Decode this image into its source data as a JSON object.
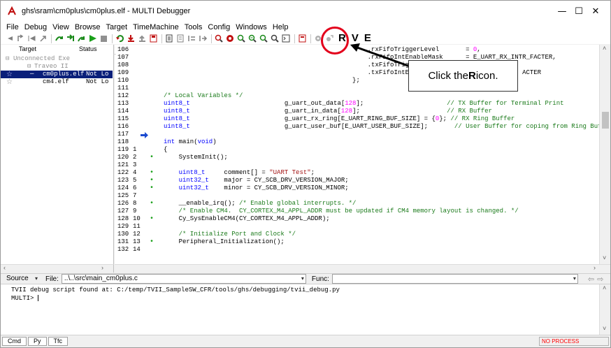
{
  "window": {
    "title": "ghs\\sram\\cm0plus\\cm0plus.elf - MULTI Debugger",
    "controls": {
      "minimize": "—",
      "maximize": "☐",
      "close": "✕"
    }
  },
  "menu": [
    "File",
    "Debug",
    "View",
    "Browse",
    "Target",
    "TimeMachine",
    "Tools",
    "Config",
    "Windows",
    "Help"
  ],
  "toolbar": {
    "letters": [
      "R",
      "V",
      "E"
    ],
    "icons": [
      "back-arrow-icon",
      "up-arrow-icon",
      "step-back-icon",
      "step-back2-icon",
      "step-over-icon",
      "step-into-icon",
      "step-out-icon",
      "run-icon",
      "halt-icon",
      "restart-icon",
      "download-icon",
      "upload-icon",
      "save-icon",
      "connect-icon",
      "memory-icon",
      "view-icon",
      "register-icon",
      "trace-icon",
      "search-icon",
      "breakpoint-icon",
      "zoom-in-icon",
      "zoom-out-icon",
      "find-icon",
      "shell-icon",
      "calc-icon",
      "settings-icon",
      "plugin-icon"
    ]
  },
  "target_pane": {
    "header": {
      "target": "Target",
      "status": "Status"
    },
    "rows": [
      {
        "label": "Unconnected Exe",
        "status": "",
        "style": "gray"
      },
      {
        "label": "Traveo II",
        "status": "",
        "style": "gray"
      },
      {
        "label": "cm0plus.elf",
        "status": "Not Lo",
        "style": "selected"
      },
      {
        "label": "cm4.elf",
        "status": "Not Lo",
        "style": "normal"
      }
    ]
  },
  "source": {
    "lines": [
      {
        "n": "106",
        "n2": "",
        "dot": false,
        "code": [
          {
            "t": "                                                      .rxFifoTriggerLevel       = ",
            "c": ""
          },
          {
            "t": "0",
            "c": "nm"
          },
          {
            "t": ",",
            "c": ""
          }
        ]
      },
      {
        "n": "107",
        "n2": "",
        "dot": false,
        "code": [
          {
            "t": "                                                      .rxFifoIntEnableMask      = E_UART_RX_INTR_FACTER,",
            "c": ""
          }
        ]
      },
      {
        "n": "108",
        "n2": "",
        "dot": false,
        "code": [
          {
            "t": "                                                      .txFifoTriggerLe",
            "c": ""
          }
        ]
      },
      {
        "n": "109",
        "n2": "",
        "dot": false,
        "code": [
          {
            "t": "                                                      .txFifoIntEnable                         ACTER",
            "c": ""
          }
        ]
      },
      {
        "n": "110",
        "n2": "",
        "dot": false,
        "code": [
          {
            "t": "                                                  };",
            "c": ""
          }
        ]
      },
      {
        "n": "111",
        "n2": "",
        "dot": false,
        "code": []
      },
      {
        "n": "112",
        "n2": "",
        "dot": false,
        "code": [
          {
            "t": "/* Local Variables */",
            "c": "cm"
          }
        ]
      },
      {
        "n": "113",
        "n2": "",
        "dot": false,
        "code": [
          {
            "t": "uint8_t",
            "c": "kw"
          },
          {
            "t": "                         g_uart_out_data[",
            "c": ""
          },
          {
            "t": "128",
            "c": "nm"
          },
          {
            "t": "];                      ",
            "c": ""
          },
          {
            "t": "// TX Buffer for Terminal Print",
            "c": "cm"
          }
        ]
      },
      {
        "n": "114",
        "n2": "",
        "dot": false,
        "code": [
          {
            "t": "uint8_t",
            "c": "kw"
          },
          {
            "t": "                         g_uart_in_data[",
            "c": ""
          },
          {
            "t": "128",
            "c": "nm"
          },
          {
            "t": "];                       ",
            "c": ""
          },
          {
            "t": "// RX Buffer",
            "c": "cm"
          }
        ]
      },
      {
        "n": "115",
        "n2": "",
        "dot": false,
        "code": [
          {
            "t": "uint8_t",
            "c": "kw"
          },
          {
            "t": "                         g_uart_rx_ring[E_UART_RING_BUF_SIZE] = {",
            "c": ""
          },
          {
            "t": "0",
            "c": "nm"
          },
          {
            "t": "}; ",
            "c": ""
          },
          {
            "t": "// RX Ring Buffer",
            "c": "cm"
          }
        ]
      },
      {
        "n": "116",
        "n2": "",
        "dot": false,
        "code": [
          {
            "t": "uint8_t",
            "c": "kw"
          },
          {
            "t": "                         g_uart_user_buf[E_UART_USER_BUF_SIZE];       ",
            "c": ""
          },
          {
            "t": "// User Buffer for coping from Ring Buffer",
            "c": "cm"
          }
        ]
      },
      {
        "n": "117",
        "n2": "",
        "dot": false,
        "code": []
      },
      {
        "n": "118",
        "n2": "",
        "dot": false,
        "code": [
          {
            "t": "int",
            "c": "kw"
          },
          {
            "t": " main(",
            "c": ""
          },
          {
            "t": "void",
            "c": "kw"
          },
          {
            "t": ")",
            "c": ""
          }
        ]
      },
      {
        "n": "119",
        "n2": "1",
        "dot": false,
        "code": [
          {
            "t": "{",
            "c": ""
          }
        ]
      },
      {
        "n": "120",
        "n2": "2",
        "dot": true,
        "code": [
          {
            "t": "    SystemInit();",
            "c": ""
          }
        ]
      },
      {
        "n": "121",
        "n2": "3",
        "dot": false,
        "code": []
      },
      {
        "n": "122",
        "n2": "4",
        "dot": true,
        "code": [
          {
            "t": "    ",
            "c": ""
          },
          {
            "t": "uint8_t",
            "c": "kw"
          },
          {
            "t": "     comment[] = ",
            "c": ""
          },
          {
            "t": "\"UART Test\"",
            "c": "st"
          },
          {
            "t": ";",
            "c": ""
          }
        ]
      },
      {
        "n": "123",
        "n2": "5",
        "dot": true,
        "code": [
          {
            "t": "    ",
            "c": ""
          },
          {
            "t": "uint32_t",
            "c": "kw"
          },
          {
            "t": "    major = CY_SCB_DRV_VERSION_MAJOR;",
            "c": ""
          }
        ]
      },
      {
        "n": "124",
        "n2": "6",
        "dot": true,
        "code": [
          {
            "t": "    ",
            "c": ""
          },
          {
            "t": "uint32_t",
            "c": "kw"
          },
          {
            "t": "    minor = CY_SCB_DRV_VERSION_MINOR;",
            "c": ""
          }
        ]
      },
      {
        "n": "125",
        "n2": "7",
        "dot": false,
        "code": []
      },
      {
        "n": "126",
        "n2": "8",
        "dot": true,
        "code": [
          {
            "t": "    __enable_irq(); ",
            "c": ""
          },
          {
            "t": "/* Enable global interrupts. */",
            "c": "cm"
          }
        ]
      },
      {
        "n": "127",
        "n2": "9",
        "dot": false,
        "code": [
          {
            "t": "    ",
            "c": ""
          },
          {
            "t": "/* Enable CM4.  CY_CORTEX_M4_APPL_ADDR must be updated if CM4 memory layout is changed. */",
            "c": "cm"
          }
        ]
      },
      {
        "n": "128",
        "n2": "10",
        "dot": true,
        "code": [
          {
            "t": "    Cy_SysEnableCM4(CY_CORTEX_M4_APPL_ADDR);",
            "c": ""
          }
        ]
      },
      {
        "n": "129",
        "n2": "11",
        "dot": false,
        "code": []
      },
      {
        "n": "130",
        "n2": "12",
        "dot": false,
        "code": [
          {
            "t": "    ",
            "c": ""
          },
          {
            "t": "/* Initialize Port and Clock */",
            "c": "cm"
          }
        ]
      },
      {
        "n": "131",
        "n2": "13",
        "dot": true,
        "code": [
          {
            "t": "    Peripheral_Initialization();",
            "c": ""
          }
        ]
      },
      {
        "n": "132",
        "n2": "14",
        "dot": false,
        "code": []
      }
    ],
    "current_line_index": 12
  },
  "filebar": {
    "mode": "Source",
    "file_label": "File:",
    "file": "..\\..\\src\\main_cm0plus.c",
    "func_label": "Func:",
    "func": ""
  },
  "command": {
    "lines": [
      "TVII debug script found at: C:/temp/TVII_SampleSW_CFR/tools/ghs/debugging/tvii_debug.py",
      "MULTI>"
    ]
  },
  "tabs": [
    "Cmd",
    "Py",
    "Tfc"
  ],
  "status": {
    "process": "NO PROCESS"
  },
  "callout": {
    "before": "Click the ",
    "bold": "R",
    "after": " icon."
  },
  "colors": {
    "highlight": "#e3001b",
    "selection": "#0a1f7a",
    "keyword": "#0000ff",
    "comment": "#1a7a1a",
    "number": "#ff00ff"
  }
}
